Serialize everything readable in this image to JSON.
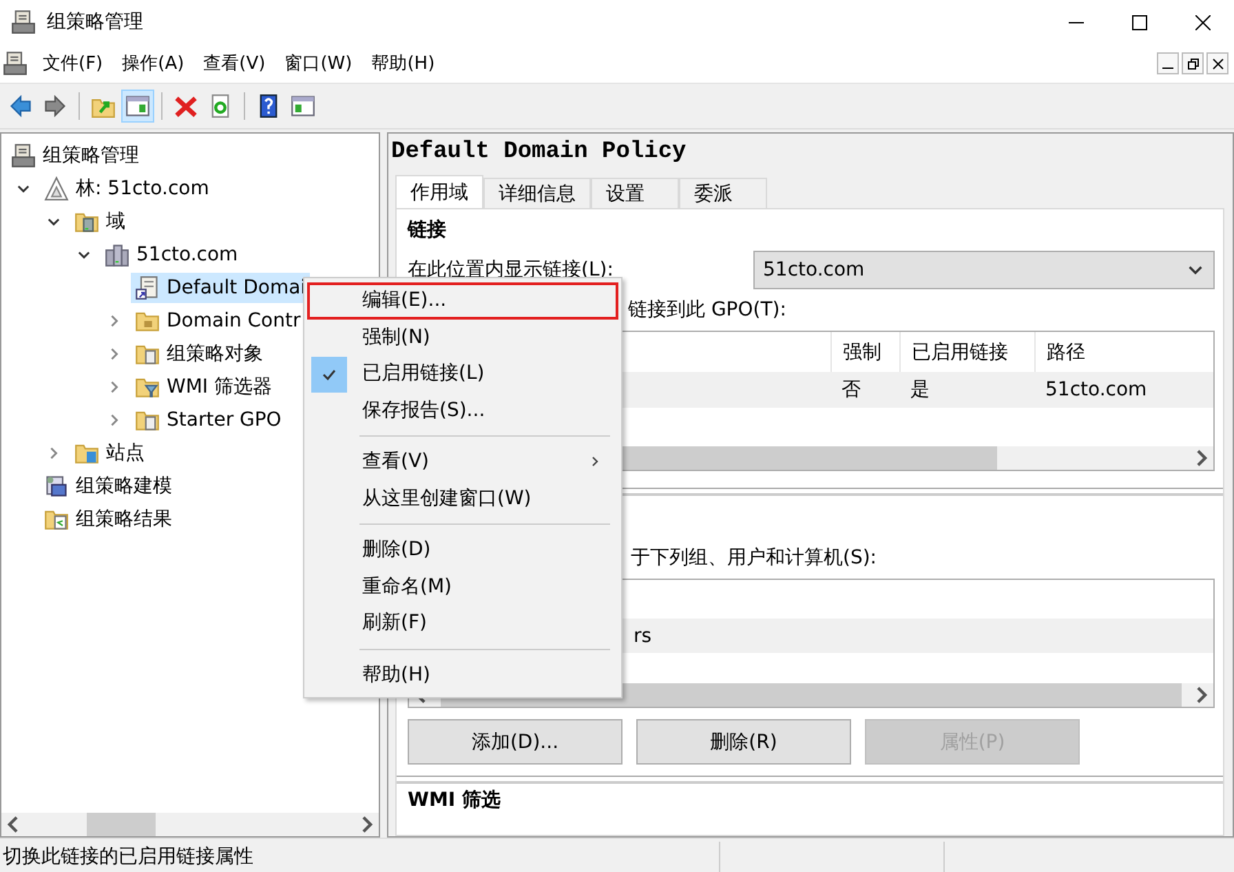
{
  "window": {
    "title": "组策略管理"
  },
  "menu_bar": [
    "文件(F)",
    "操作(A)",
    "查看(V)",
    "窗口(W)",
    "帮助(H)"
  ],
  "toolbar": [
    {
      "kind": "back",
      "active": false
    },
    {
      "kind": "forward",
      "active": false
    },
    {
      "kind": "separator"
    },
    {
      "kind": "up",
      "active": false
    },
    {
      "kind": "tree",
      "active": true
    },
    {
      "kind": "separator"
    },
    {
      "kind": "delete",
      "active": false
    },
    {
      "kind": "refresh",
      "active": false
    },
    {
      "kind": "separator"
    },
    {
      "kind": "help",
      "active": false
    },
    {
      "kind": "pane",
      "active": false
    }
  ],
  "tree": [
    {
      "label": "组策略管理",
      "kind": "scroll",
      "selected": false,
      "children": [
        {
          "label": "林: 51cto.com",
          "kind": "forest",
          "expanded": true,
          "selected": false,
          "children": [
            {
              "label": "域",
              "kind": "domains",
              "expanded": true,
              "selected": false,
              "children": [
                {
                  "label": "51cto.com",
                  "kind": "server",
                  "expanded": true,
                  "selected": false,
                  "children": [
                    {
                      "label": "Default Domai",
                      "kind": "gpo-link",
                      "selected": true
                    },
                    {
                      "label": "Domain Contr",
                      "kind": "folder",
                      "expanded": false,
                      "selected": false
                    },
                    {
                      "label": "组策略对象",
                      "kind": "folder-scroll",
                      "expanded": false,
                      "selected": false
                    },
                    {
                      "label": "WMI 筛选器",
                      "kind": "folder-filter",
                      "expanded": false,
                      "selected": false
                    },
                    {
                      "label": "Starter GPO",
                      "kind": "folder-scroll",
                      "expanded": false,
                      "selected": false
                    }
                  ]
                }
              ]
            },
            {
              "label": "站点",
              "kind": "folder-site",
              "expanded": false,
              "selected": false
            }
          ]
        },
        {
          "label": "组策略建模",
          "kind": "modeling",
          "selected": false
        },
        {
          "label": "组策略结果",
          "kind": "folder-result",
          "selected": false
        }
      ]
    }
  ],
  "details": {
    "title": "Default Domain Policy",
    "tabs": [
      {
        "label": "作用域",
        "selected": true
      },
      {
        "label": "详细信息",
        "selected": false
      },
      {
        "label": "设置",
        "selected": false
      },
      {
        "label": "委派",
        "selected": false
      }
    ],
    "links_heading": "链接",
    "location_label": "在此位置内显示链接(L):",
    "location_value": "51cto.com",
    "links_label": "链接到此 GPO(T):",
    "links_table": {
      "columns": [
        "强制",
        "已启用链接",
        "路径"
      ],
      "rows": [
        {
          "cells": [
            "否",
            "是",
            "51cto.com"
          ],
          "selected": true
        }
      ]
    },
    "filter_label": "于下列组、用户和计算机(S):",
    "filter_list": [
      {
        "text": "rs",
        "selected": true
      }
    ],
    "buttons": [
      {
        "label": "添加(D)...",
        "disabled": false
      },
      {
        "label": "删除(R)",
        "disabled": false
      },
      {
        "label": "属性(P)",
        "disabled": true
      }
    ],
    "wmi_heading": "WMI 筛选"
  },
  "context_menu": [
    {
      "kind": "item",
      "label": "编辑(E)...",
      "highlighted": true,
      "checked": false,
      "submenu": false
    },
    {
      "kind": "item",
      "label": "强制(N)",
      "highlighted": false,
      "checked": false,
      "submenu": false
    },
    {
      "kind": "item",
      "label": "已启用链接(L)",
      "highlighted": false,
      "checked": true,
      "submenu": false
    },
    {
      "kind": "item",
      "label": "保存报告(S)...",
      "highlighted": false,
      "checked": false,
      "submenu": false
    },
    {
      "kind": "separator"
    },
    {
      "kind": "item",
      "label": "查看(V)",
      "highlighted": false,
      "checked": false,
      "submenu": true
    },
    {
      "kind": "item",
      "label": "从这里创建窗口(W)",
      "highlighted": false,
      "checked": false,
      "submenu": false
    },
    {
      "kind": "separator"
    },
    {
      "kind": "item",
      "label": "删除(D)",
      "highlighted": false,
      "checked": false,
      "submenu": false
    },
    {
      "kind": "item",
      "label": "重命名(M)",
      "highlighted": false,
      "checked": false,
      "submenu": false
    },
    {
      "kind": "item",
      "label": "刷新(F)",
      "highlighted": false,
      "checked": false,
      "submenu": false
    },
    {
      "kind": "separator"
    },
    {
      "kind": "item",
      "label": "帮助(H)",
      "highlighted": false,
      "checked": false,
      "submenu": false
    }
  ],
  "status_bar": {
    "text": "切换此链接的已启用链接属性"
  }
}
